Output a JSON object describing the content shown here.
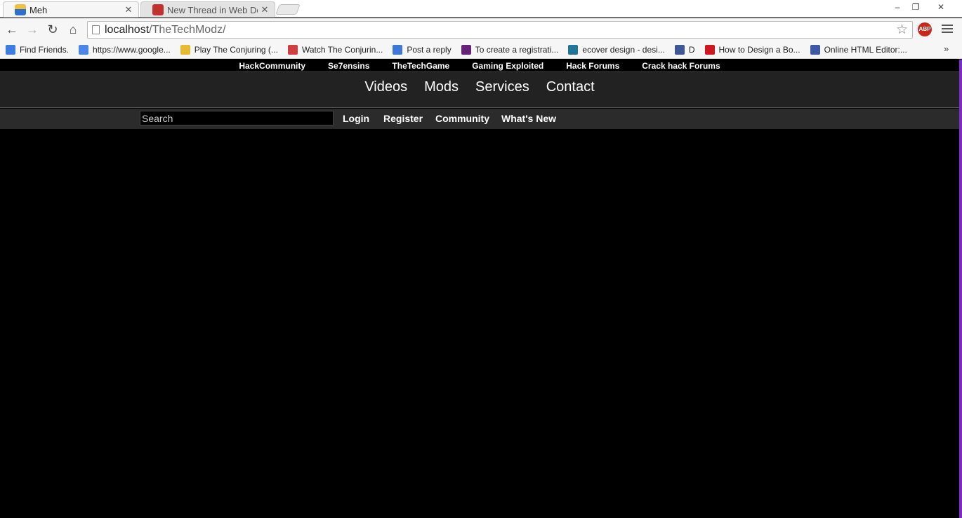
{
  "tabs": [
    {
      "label": "Meh",
      "favicon": "user-favicon-icon",
      "active": true
    },
    {
      "label": "New Thread in Web Devel",
      "favicon": "forum-favicon-icon",
      "active": false
    }
  ],
  "window_controls": {
    "minimize": "–",
    "maximize": "❐",
    "close": "✕"
  },
  "toolbar": {
    "back": "←",
    "forward": "→",
    "reload": "↻",
    "home": "⌂",
    "url_host": "localhost",
    "url_path": "/TheTechModz/",
    "star": "☆",
    "abp": "ABP"
  },
  "bookmarks": [
    {
      "label": "Find Friends.",
      "icon": "friends-icon",
      "color": "#3b7de0"
    },
    {
      "label": "https://www.google...",
      "icon": "google-icon",
      "color": "#4a86e8"
    },
    {
      "label": "Play The Conjuring (...",
      "icon": "bolt-icon",
      "color": "#e8b830"
    },
    {
      "label": "Watch The Conjurin...",
      "icon": "globe-icon",
      "color": "#d04040"
    },
    {
      "label": "Post a reply",
      "icon": "chrome-icon",
      "color": "#3c78d8"
    },
    {
      "label": "To create a registrati...",
      "icon": "vs-icon",
      "color": "#68217a"
    },
    {
      "label": "ecover design - desi...",
      "icon": "wp-icon",
      "color": "#21759b"
    },
    {
      "label": "D",
      "icon": "facebook-icon",
      "color": "#3b5998"
    },
    {
      "label": "How to Design a Bo...",
      "icon": "youtube-icon",
      "color": "#cc181e"
    },
    {
      "label": "Online HTML Editor:...",
      "icon": "jw-icon",
      "color": "#3a5aa8"
    }
  ],
  "bookmarks_more": "»",
  "site": {
    "top_links": [
      "HackCommunity",
      "Se7ensins",
      "TheTechGame",
      "Gaming Exploited",
      "Hack Forums",
      "Crack hack Forums"
    ],
    "main_nav": [
      "Videos",
      "Mods",
      "Services",
      "Contact"
    ],
    "search_placeholder": "Search",
    "sub_nav": [
      "Login",
      "Register",
      "Community",
      "What's New"
    ]
  }
}
